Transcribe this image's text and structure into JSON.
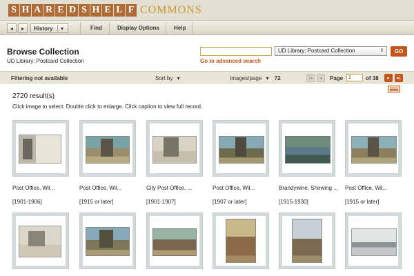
{
  "logo": {
    "letters": [
      "S",
      "H",
      "A",
      "R",
      "E",
      "D",
      "S",
      "H",
      "E",
      "L",
      "F"
    ],
    "suffix": "COMMONS"
  },
  "toolbar": {
    "back_label": "◂",
    "forward_label": "▸",
    "history_label": "History",
    "history_arrow": "▾",
    "find_label": "Find",
    "display_label": "Display Options",
    "help_label": "Help"
  },
  "browse": {
    "title": "Browse Collection",
    "collection_name": "UD Library: Postcard Collection",
    "selected_collection": "UD Library: Postcard Collection",
    "advanced_search": "Go to advanced search",
    "go_label": "GO"
  },
  "filterbar": {
    "filtering_text": "Filtering not available",
    "sort_label": "Sort by",
    "images_label": "Images/page",
    "images_value": "72",
    "page_label": "Page",
    "page_value": "1",
    "of_label": "of 38"
  },
  "results": {
    "count": "2720 result(s)",
    "instructions": "Click image to select. Double click to enlarge. Click caption to view full record."
  },
  "items_row1": [
    {
      "caption": "Post Office, Wil...",
      "date": "[1901-1906]"
    },
    {
      "caption": "Post Office, Wil...",
      "date": "[1915 or later]"
    },
    {
      "caption": "City Post Office, ...",
      "date": "[1901-1907]"
    },
    {
      "caption": "Post Office, Wil...",
      "date": "[1907 or later]"
    },
    {
      "caption": "Brandywine, Showing ...",
      "date": "[1915-1930]"
    },
    {
      "caption": "Post Office, Wil...",
      "date": "[1915 or later]"
    }
  ],
  "colors": {
    "accent": "#c4541a",
    "logo_box": "#b06a34",
    "logo_text": "#c79a2e"
  }
}
